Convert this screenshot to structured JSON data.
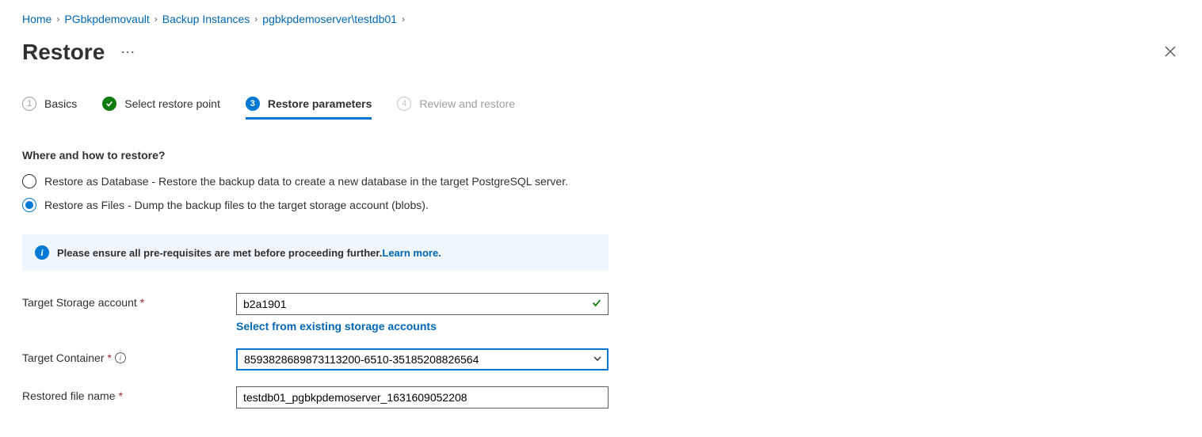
{
  "breadcrumb": {
    "items": [
      "Home",
      "PGbkpdemovault",
      "Backup Instances",
      "pgbkpdemoserver\\testdb01"
    ]
  },
  "page": {
    "title": "Restore"
  },
  "tabs": {
    "basics": "Basics",
    "select_restore_point": "Select restore point",
    "restore_parameters": "Restore parameters",
    "review_restore": "Review and restore",
    "num_1": "1",
    "num_3": "3",
    "num_4": "4"
  },
  "section": {
    "heading": "Where and how to restore?"
  },
  "radios": {
    "database": "Restore as Database - Restore the backup data to create a new database in the target PostgreSQL server.",
    "files": "Restore as Files - Dump the backup files to the target storage account (blobs)."
  },
  "info": {
    "text": "Please ensure all pre-requisites are met before proceeding further.",
    "link": "Learn more."
  },
  "form": {
    "storage_account": {
      "label": "Target Storage account",
      "value": "b2a1901",
      "link": "Select from existing storage accounts"
    },
    "container": {
      "label": "Target Container",
      "value": "8593828689873113200-6510-35185208826564"
    },
    "filename": {
      "label": "Restored file name",
      "value": "testdb01_pgbkpdemoserver_1631609052208"
    }
  }
}
